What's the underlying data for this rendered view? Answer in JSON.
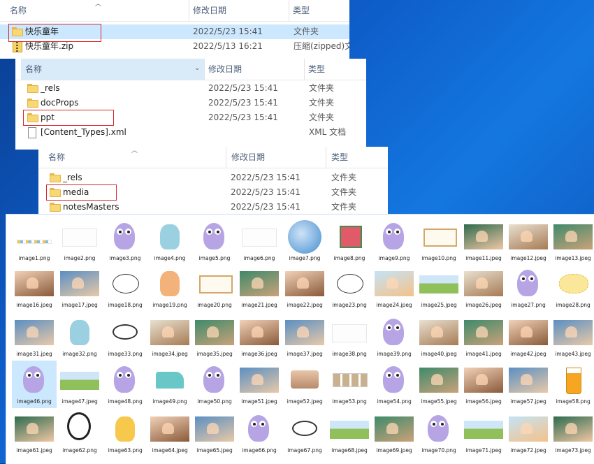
{
  "explorer": {
    "col_name": "名称",
    "col_date": "修改日期",
    "col_type": "类型"
  },
  "window1": {
    "rows": [
      {
        "name": "快乐童年",
        "date": "2022/5/23 15:41",
        "type": "文件夹",
        "icon": "folder-icon",
        "selected": true
      },
      {
        "name": "快乐童年.zip",
        "date": "2022/5/13 16:21",
        "type": "压缩(zipped)文",
        "icon": "zip-icon",
        "selected": false
      }
    ]
  },
  "window2": {
    "rows": [
      {
        "name": "_rels",
        "date": "2022/5/23 15:41",
        "type": "文件夹",
        "icon": "folder-icon"
      },
      {
        "name": "docProps",
        "date": "2022/5/23 15:41",
        "type": "文件夹",
        "icon": "folder-icon"
      },
      {
        "name": "ppt",
        "date": "2022/5/23 15:41",
        "type": "文件夹",
        "icon": "folder-icon"
      },
      {
        "name": "[Content_Types].xml",
        "date": "",
        "type": "XML 文档",
        "icon": "xml-document-icon"
      }
    ]
  },
  "window3": {
    "rows": [
      {
        "name": "_rels",
        "date": "2022/5/23 15:41",
        "type": "文件夹",
        "icon": "folder-icon"
      },
      {
        "name": "media",
        "date": "2022/5/23 15:41",
        "type": "文件夹",
        "icon": "folder-icon"
      },
      {
        "name": "notesMasters",
        "date": "2022/5/23 15:41",
        "type": "文件夹",
        "icon": "folder-icon"
      }
    ]
  },
  "gallery": {
    "rows": [
      [
        {
          "n": "image1.png",
          "k": "banner"
        },
        {
          "n": "image2.png",
          "k": "blank"
        },
        {
          "n": "image3.png",
          "k": "dino"
        },
        {
          "n": "image4.png",
          "k": "cartoon"
        },
        {
          "n": "image5.png",
          "k": "dino"
        },
        {
          "n": "image6.png",
          "k": "blank"
        },
        {
          "n": "image7.png",
          "k": "globe"
        },
        {
          "n": "image8.png",
          "k": "gift"
        },
        {
          "n": "image9.png",
          "k": "dino"
        },
        {
          "n": "image10.png",
          "k": "frame"
        },
        {
          "n": "image11.jpeg",
          "k": "photo"
        },
        {
          "n": "image12.jpeg",
          "k": "photo"
        },
        {
          "n": "image13.jpeg",
          "k": "photo"
        }
      ],
      [
        {
          "n": "image16.jpeg",
          "k": "photo"
        },
        {
          "n": "image17.jpeg",
          "k": "photo"
        },
        {
          "n": "image18.png",
          "k": "bubble"
        },
        {
          "n": "image19.png",
          "k": "cartoon"
        },
        {
          "n": "image20.png",
          "k": "frame"
        },
        {
          "n": "image21.jpeg",
          "k": "photo"
        },
        {
          "n": "image22.jpeg",
          "k": "photo"
        },
        {
          "n": "image23.png",
          "k": "bubble"
        },
        {
          "n": "image24.jpeg",
          "k": "photo"
        },
        {
          "n": "image25.jpeg",
          "k": "field"
        },
        {
          "n": "image26.jpeg",
          "k": "photo"
        },
        {
          "n": "image27.png",
          "k": "dino"
        },
        {
          "n": "image28.png",
          "k": "cloudy"
        }
      ],
      [
        {
          "n": "image31.jpeg",
          "k": "photo"
        },
        {
          "n": "image32.png",
          "k": "cartoon"
        },
        {
          "n": "image33.png",
          "k": "ring2"
        },
        {
          "n": "image34.jpeg",
          "k": "photo"
        },
        {
          "n": "image35.jpeg",
          "k": "photo"
        },
        {
          "n": "image36.jpeg",
          "k": "photo"
        },
        {
          "n": "image37.jpeg",
          "k": "photo"
        },
        {
          "n": "image38.png",
          "k": "blank"
        },
        {
          "n": "image39.png",
          "k": "dino"
        },
        {
          "n": "image40.jpeg",
          "k": "photo"
        },
        {
          "n": "image41.jpeg",
          "k": "photo"
        },
        {
          "n": "image42.jpeg",
          "k": "photo"
        },
        {
          "n": "image43.jpeg",
          "k": "photo"
        }
      ],
      [
        {
          "n": "image46.png",
          "k": "dino",
          "sel": true
        },
        {
          "n": "image47.jpeg",
          "k": "field"
        },
        {
          "n": "image48.png",
          "k": "dino"
        },
        {
          "n": "image49.png",
          "k": "piano"
        },
        {
          "n": "image50.png",
          "k": "dino"
        },
        {
          "n": "image51.jpeg",
          "k": "photo"
        },
        {
          "n": "image52.jpeg",
          "k": "books"
        },
        {
          "n": "image53.png",
          "k": "pics"
        },
        {
          "n": "image54.png",
          "k": "dino"
        },
        {
          "n": "image55.jpeg",
          "k": "photo"
        },
        {
          "n": "image56.jpeg",
          "k": "photo"
        },
        {
          "n": "image57.jpeg",
          "k": "photo"
        },
        {
          "n": "image58.png",
          "k": "juice"
        }
      ],
      [
        {
          "n": "image61.jpeg",
          "k": "photo"
        },
        {
          "n": "image62.png",
          "k": "ring"
        },
        {
          "n": "image63.png",
          "k": "cartoon"
        },
        {
          "n": "image64.jpeg",
          "k": "photo"
        },
        {
          "n": "image65.jpeg",
          "k": "photo"
        },
        {
          "n": "image66.png",
          "k": "dino"
        },
        {
          "n": "image67.png",
          "k": "ring2"
        },
        {
          "n": "image68.jpeg",
          "k": "field"
        },
        {
          "n": "image69.jpeg",
          "k": "photo"
        },
        {
          "n": "image70.png",
          "k": "dino"
        },
        {
          "n": "image71.jpeg",
          "k": "field"
        },
        {
          "n": "image72.jpeg",
          "k": "photo"
        },
        {
          "n": "image73.jpeg",
          "k": "photo"
        }
      ]
    ]
  },
  "colors": {
    "selection": "#cce8ff",
    "highlight_box": "#d8262e",
    "folder": "#f8d775",
    "desktop": "#0e5cc8"
  }
}
